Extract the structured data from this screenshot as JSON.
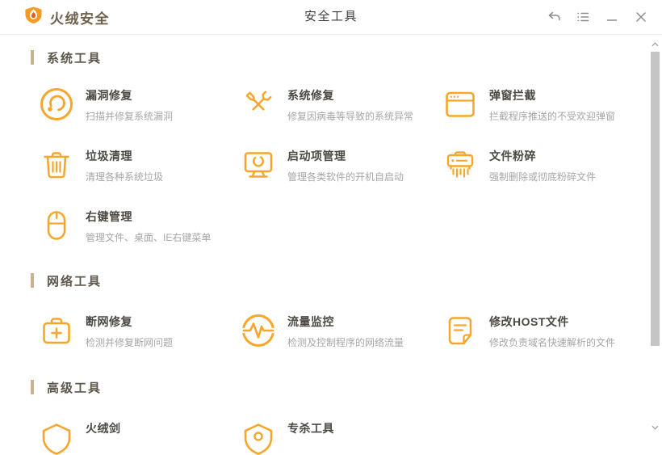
{
  "colors": {
    "accent": "#F8A62B",
    "brand_text": "#6E614C",
    "page_title_text": "#3D3D3D",
    "section_bar": "#C9B28E",
    "section_title_text": "#5E574B",
    "item_title_text": "#4C4842",
    "item_desc_text": "#A6A6A6",
    "window_control": "#8C8C8C",
    "topbar_border": "#EDEDED",
    "scrollbar_thumb": "#C5C5C5"
  },
  "titlebar": {
    "app_name": "火绒安全",
    "page_title": "安全工具",
    "icons": [
      "huorong-logo",
      "undo-arrow",
      "list-menu",
      "minimize",
      "close"
    ]
  },
  "sections": [
    {
      "title": "系统工具",
      "items": [
        {
          "icon": "patch-circle-icon",
          "title": "漏洞修复",
          "desc": "扫描并修复系统漏洞"
        },
        {
          "icon": "wrench-screwdriver-icon",
          "title": "系统修复",
          "desc": "修复因病毒等导致的系统异常"
        },
        {
          "icon": "popup-window-icon",
          "title": "弹窗拦截",
          "desc": "拦截程序推送的不受欢迎弹窗"
        },
        {
          "icon": "trash-icon",
          "title": "垃圾清理",
          "desc": "清理各种系统垃圾"
        },
        {
          "icon": "monitor-icon",
          "title": "启动项管理",
          "desc": "管理各类软件的开机自启动"
        },
        {
          "icon": "shredder-icon",
          "title": "文件粉碎",
          "desc": "强制删除或彻底粉碎文件"
        },
        {
          "icon": "mouse-icon",
          "title": "右键管理",
          "desc": "管理文件、桌面、IE右键菜单"
        }
      ]
    },
    {
      "title": "网络工具",
      "items": [
        {
          "icon": "first-aid-kit-icon",
          "title": "断网修复",
          "desc": "检测并修复断网问题"
        },
        {
          "icon": "pulse-circle-icon",
          "title": "流量监控",
          "desc": "检测及控制程序的网络流量"
        },
        {
          "icon": "document-icon",
          "title": "修改HOST文件",
          "desc": "修改负责域名快速解析的文件"
        }
      ]
    },
    {
      "title": "高级工具",
      "items": [
        {
          "icon": "shield-sword-icon",
          "title": "火绒剑",
          "desc": ""
        },
        {
          "icon": "shield-target-icon",
          "title": "专杀工具",
          "desc": ""
        }
      ]
    }
  ]
}
